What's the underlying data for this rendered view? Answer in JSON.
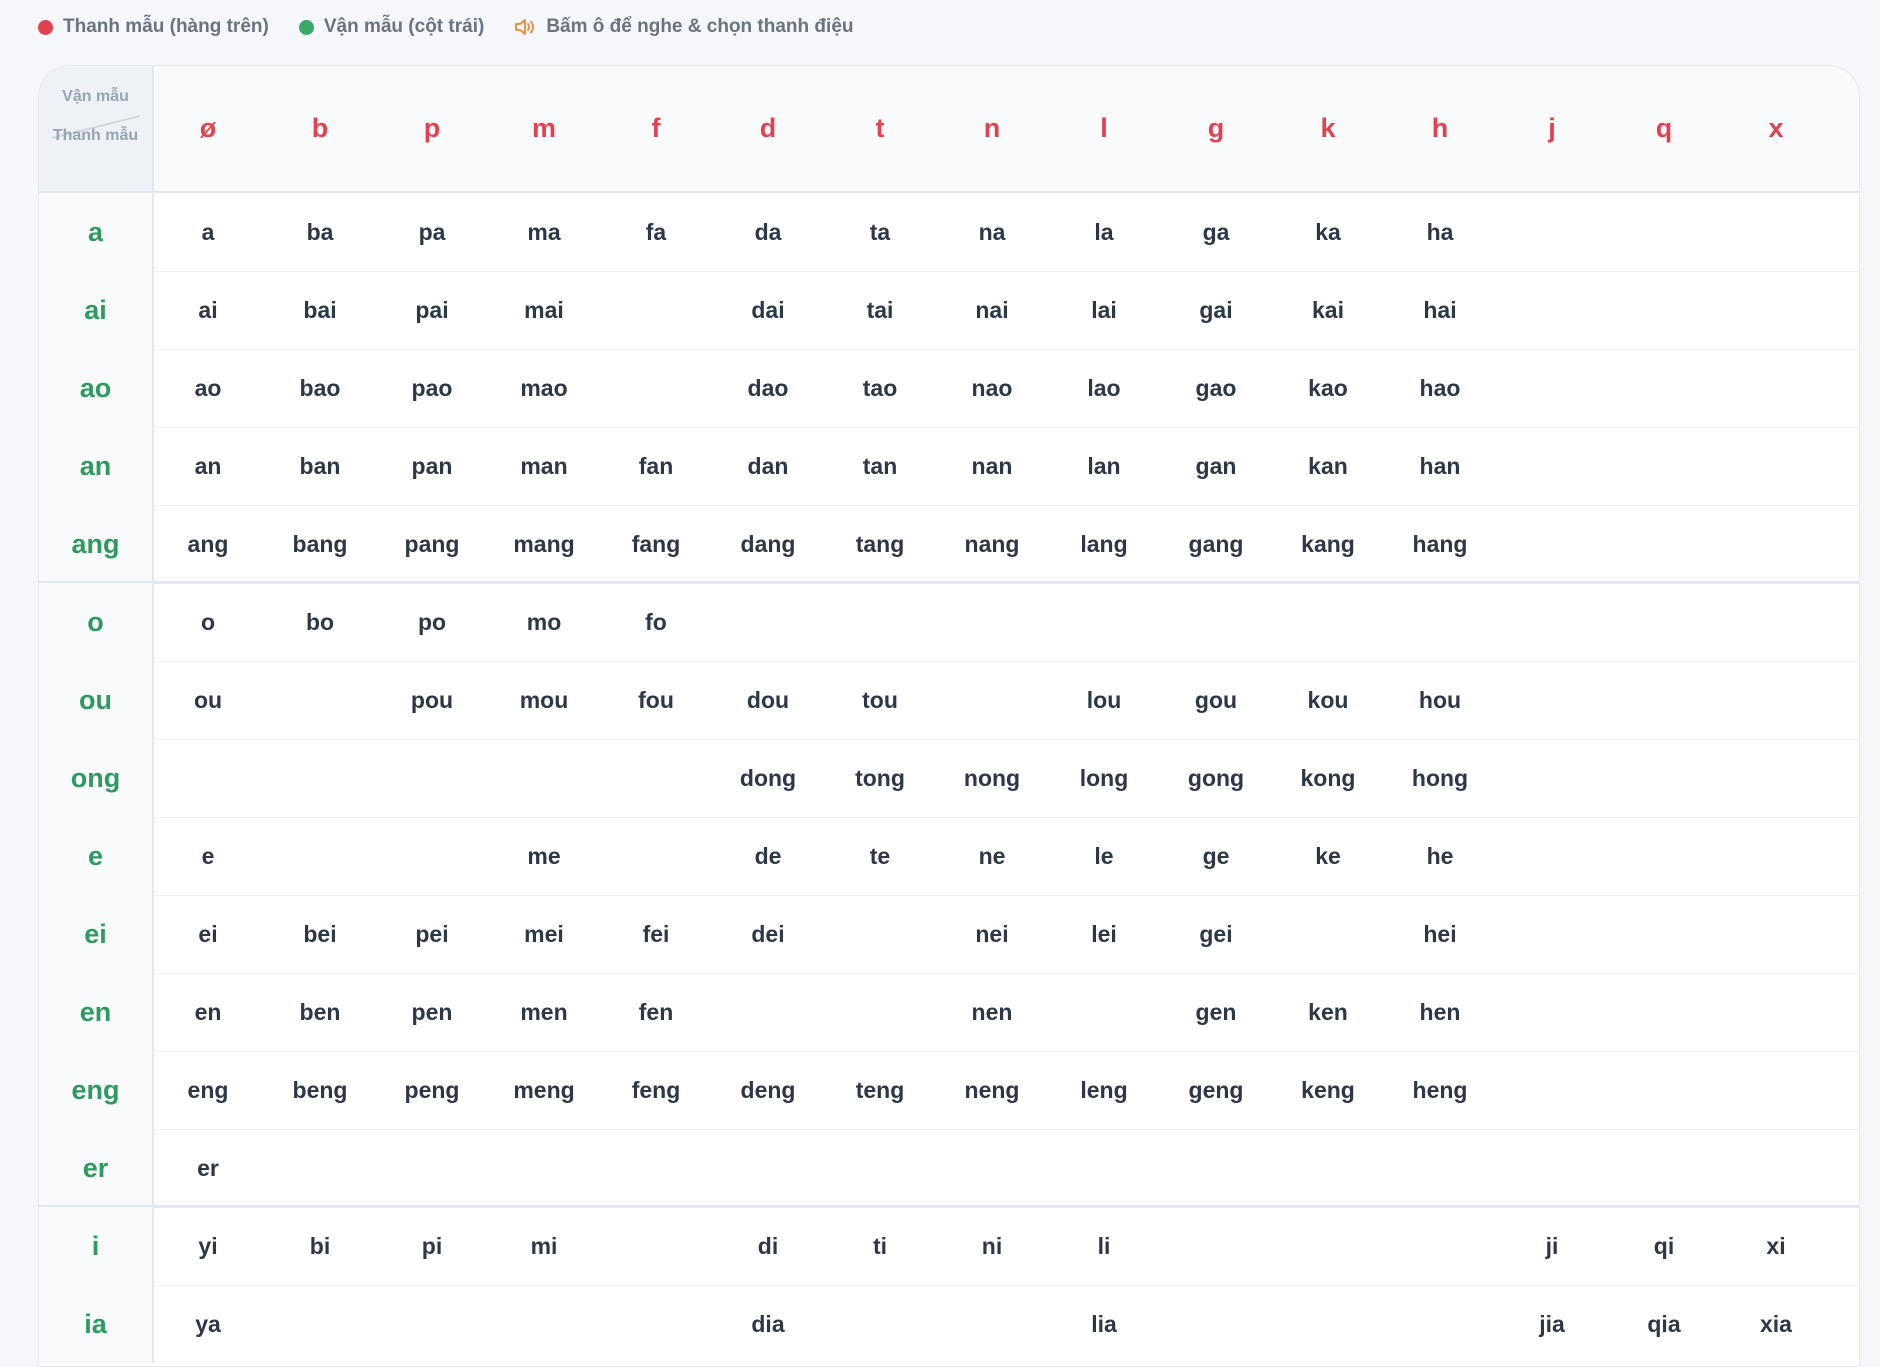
{
  "legend": {
    "initials_label": "Thanh mẫu (hàng trên)",
    "finals_label": "Vận mẫu (cột trái)",
    "hint_label": "Bấm ô để nghe & chọn thanh điệu",
    "colors": {
      "initial": "#e0434f",
      "final": "#3aa86b",
      "hint": "#e8883a"
    },
    "icons": [
      "red-dot-icon",
      "green-dot-icon",
      "speaker-icon"
    ]
  },
  "corner": {
    "finals": "Vận mẫu",
    "initials": "Thanh mẫu"
  },
  "initials": [
    "ø",
    "b",
    "p",
    "m",
    "f",
    "d",
    "t",
    "n",
    "l",
    "g",
    "k",
    "h",
    "j",
    "q",
    "x"
  ],
  "rows": [
    {
      "final": "a",
      "cells": [
        "a",
        "ba",
        "pa",
        "ma",
        "fa",
        "da",
        "ta",
        "na",
        "la",
        "ga",
        "ka",
        "ha",
        "",
        "",
        ""
      ]
    },
    {
      "final": "ai",
      "cells": [
        "ai",
        "bai",
        "pai",
        "mai",
        "",
        "dai",
        "tai",
        "nai",
        "lai",
        "gai",
        "kai",
        "hai",
        "",
        "",
        ""
      ]
    },
    {
      "final": "ao",
      "cells": [
        "ao",
        "bao",
        "pao",
        "mao",
        "",
        "dao",
        "tao",
        "nao",
        "lao",
        "gao",
        "kao",
        "hao",
        "",
        "",
        ""
      ]
    },
    {
      "final": "an",
      "cells": [
        "an",
        "ban",
        "pan",
        "man",
        "fan",
        "dan",
        "tan",
        "nan",
        "lan",
        "gan",
        "kan",
        "han",
        "",
        "",
        ""
      ]
    },
    {
      "final": "ang",
      "cells": [
        "ang",
        "bang",
        "pang",
        "mang",
        "fang",
        "dang",
        "tang",
        "nang",
        "lang",
        "gang",
        "kang",
        "hang",
        "",
        "",
        ""
      ]
    },
    {
      "final": "o",
      "group_start": true,
      "cells": [
        "o",
        "bo",
        "po",
        "mo",
        "fo",
        "",
        "",
        "",
        "",
        "",
        "",
        "",
        "",
        "",
        ""
      ]
    },
    {
      "final": "ou",
      "cells": [
        "ou",
        "",
        "pou",
        "mou",
        "fou",
        "dou",
        "tou",
        "",
        "lou",
        "gou",
        "kou",
        "hou",
        "",
        "",
        ""
      ]
    },
    {
      "final": "ong",
      "cells": [
        "",
        "",
        "",
        "",
        "",
        "dong",
        "tong",
        "nong",
        "long",
        "gong",
        "kong",
        "hong",
        "",
        "",
        ""
      ]
    },
    {
      "final": "e",
      "cells": [
        "e",
        "",
        "",
        "me",
        "",
        "de",
        "te",
        "ne",
        "le",
        "ge",
        "ke",
        "he",
        "",
        "",
        ""
      ]
    },
    {
      "final": "ei",
      "cells": [
        "ei",
        "bei",
        "pei",
        "mei",
        "fei",
        "dei",
        "",
        "nei",
        "lei",
        "gei",
        "",
        "hei",
        "",
        "",
        ""
      ]
    },
    {
      "final": "en",
      "cells": [
        "en",
        "ben",
        "pen",
        "men",
        "fen",
        "",
        "",
        "nen",
        "",
        "gen",
        "ken",
        "hen",
        "",
        "",
        ""
      ]
    },
    {
      "final": "eng",
      "cells": [
        "eng",
        "beng",
        "peng",
        "meng",
        "feng",
        "deng",
        "teng",
        "neng",
        "leng",
        "geng",
        "keng",
        "heng",
        "",
        "",
        ""
      ]
    },
    {
      "final": "er",
      "cells": [
        "er",
        "",
        "",
        "",
        "",
        "",
        "",
        "",
        "",
        "",
        "",
        "",
        "",
        "",
        ""
      ]
    },
    {
      "final": "i",
      "group_start": true,
      "cells": [
        "yi",
        "bi",
        "pi",
        "mi",
        "",
        "di",
        "ti",
        "ni",
        "li",
        "",
        "",
        "",
        "ji",
        "qi",
        "xi"
      ]
    },
    {
      "final": "ia",
      "cells": [
        "ya",
        "",
        "",
        "",
        "",
        "dia",
        "",
        "",
        "lia",
        "",
        "",
        "",
        "jia",
        "qia",
        "xia"
      ]
    }
  ]
}
